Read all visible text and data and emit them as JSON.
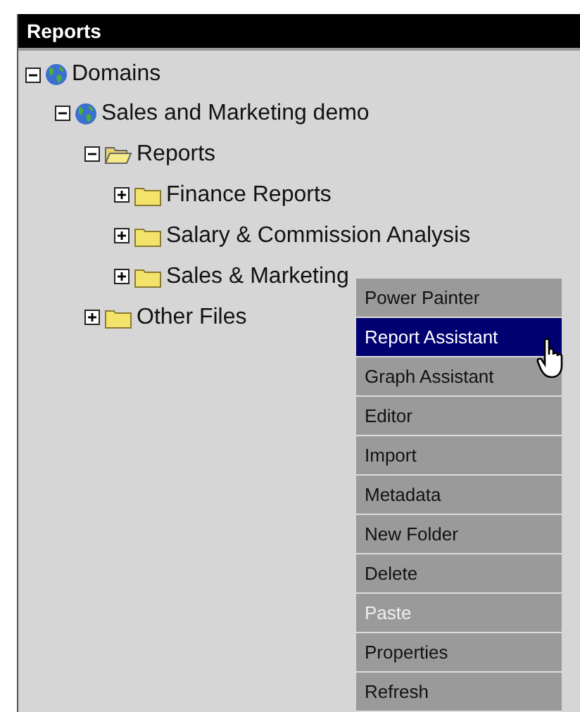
{
  "panel": {
    "title": "Reports"
  },
  "tree": [
    {
      "label": "Domains",
      "kind": "globe",
      "expanded": true,
      "children": [
        {
          "label": "Sales and Marketing demo",
          "kind": "globe",
          "expanded": true,
          "children": [
            {
              "label": "Reports",
              "kind": "folder",
              "expanded": true,
              "children": [
                {
                  "label": "Finance Reports",
                  "kind": "folder",
                  "expanded": false
                },
                {
                  "label": "Salary & Commission Analysis",
                  "kind": "folder",
                  "expanded": false
                },
                {
                  "label": "Sales & Marketing",
                  "kind": "folder",
                  "expanded": false
                }
              ]
            },
            {
              "label": "Other Files",
              "kind": "folder",
              "expanded": false
            }
          ]
        }
      ]
    }
  ],
  "context_menu": {
    "items": [
      {
        "label": "Power Painter",
        "selected": false,
        "disabled": false
      },
      {
        "label": "Report Assistant",
        "selected": true,
        "disabled": false
      },
      {
        "label": "Graph Assistant",
        "selected": false,
        "disabled": false
      },
      {
        "label": "Editor",
        "selected": false,
        "disabled": false
      },
      {
        "label": "Import",
        "selected": false,
        "disabled": false
      },
      {
        "label": "Metadata",
        "selected": false,
        "disabled": false
      },
      {
        "label": "New Folder",
        "selected": false,
        "disabled": false
      },
      {
        "label": "Delete",
        "selected": false,
        "disabled": false
      },
      {
        "label": "Paste",
        "selected": false,
        "disabled": true
      },
      {
        "label": "Properties",
        "selected": false,
        "disabled": false
      },
      {
        "label": "Refresh",
        "selected": false,
        "disabled": false
      }
    ]
  }
}
